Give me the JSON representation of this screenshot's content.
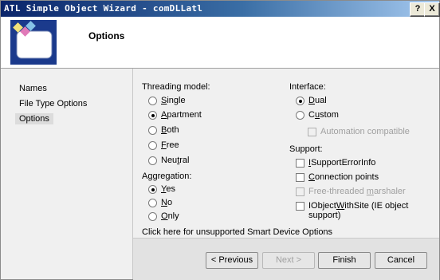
{
  "window": {
    "title": "ATL Simple Object Wizard - comDLLatl",
    "help_glyph": "?",
    "close_glyph": "X"
  },
  "header": {
    "title": "Options"
  },
  "nav": {
    "items": [
      "Names",
      "File Type Options",
      "Options"
    ]
  },
  "threading": {
    "label": "Threading model:",
    "options": [
      {
        "pre": "",
        "key": "S",
        "post": "ingle",
        "selected": false
      },
      {
        "pre": "",
        "key": "A",
        "post": "partment",
        "selected": true
      },
      {
        "pre": "",
        "key": "B",
        "post": "oth",
        "selected": false
      },
      {
        "pre": "",
        "key": "F",
        "post": "ree",
        "selected": false
      },
      {
        "pre": "Neu",
        "key": "t",
        "post": "ral",
        "selected": false
      }
    ]
  },
  "aggregation": {
    "label": "Aggregation:",
    "options": [
      {
        "pre": "",
        "key": "Y",
        "post": "es",
        "selected": true
      },
      {
        "pre": "",
        "key": "N",
        "post": "o",
        "selected": false
      },
      {
        "pre": "",
        "key": "O",
        "post": "nly",
        "selected": false
      }
    ]
  },
  "interface": {
    "label": "Interface:",
    "options": [
      {
        "pre": "",
        "key": "D",
        "post": "ual",
        "selected": true
      },
      {
        "pre": "C",
        "key": "u",
        "post": "stom",
        "selected": false
      }
    ],
    "automation": "Automation compatible"
  },
  "support": {
    "label": "Support:",
    "isupport": {
      "pre": "",
      "key": "I",
      "post": "SupportErrorInfo"
    },
    "connection": {
      "pre": "",
      "key": "C",
      "post": "onnection points"
    },
    "freethreaded": {
      "pre": "Free-threaded ",
      "key": "m",
      "post": "arshaler"
    },
    "iobject_line1": {
      "pre": "IObject",
      "key": "W",
      "post": "ithSite (IE object"
    },
    "iobject_line2": "support)"
  },
  "smart_device_link": "Click here for unsupported Smart Device Options",
  "buttons": {
    "previous": "< Previous",
    "next": "Next >",
    "finish": "Finish",
    "cancel": "Cancel"
  }
}
